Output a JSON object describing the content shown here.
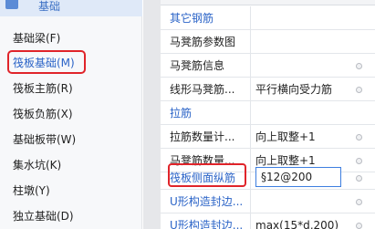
{
  "sidebar": {
    "category_label": "基础",
    "items": [
      {
        "label": "基础梁(F)"
      },
      {
        "label": "筏板基础(M)"
      },
      {
        "label": "筏板主筋(R)"
      },
      {
        "label": "筏板负筋(X)"
      },
      {
        "label": "基础板带(W)"
      },
      {
        "label": "集水坑(K)"
      },
      {
        "label": "柱墩(Y)"
      },
      {
        "label": "独立基础(D)"
      }
    ]
  },
  "properties": {
    "rows": [
      {
        "name": "其它钢筋",
        "value": "",
        "blue": true
      },
      {
        "name": "马凳筋参数图",
        "value": "",
        "blue": false
      },
      {
        "name": "马凳筋信息",
        "value": "",
        "blue": false
      },
      {
        "name": "线形马凳筋...",
        "value": "平行横向受力筋",
        "blue": false
      },
      {
        "name": "拉筋",
        "value": "",
        "blue": true
      },
      {
        "name": "拉筋数量计...",
        "value": "向上取整+1",
        "blue": false
      },
      {
        "name": "马凳筋数量...",
        "value": "向上取整+1",
        "blue": false
      },
      {
        "name": "筏板侧面纵筋",
        "value": "§12@200",
        "blue": true
      },
      {
        "name": "U形构造封边...",
        "value": "",
        "blue": true
      },
      {
        "name": "U形构造封边...",
        "value": "max(15*d,200)",
        "blue": true
      }
    ]
  }
}
